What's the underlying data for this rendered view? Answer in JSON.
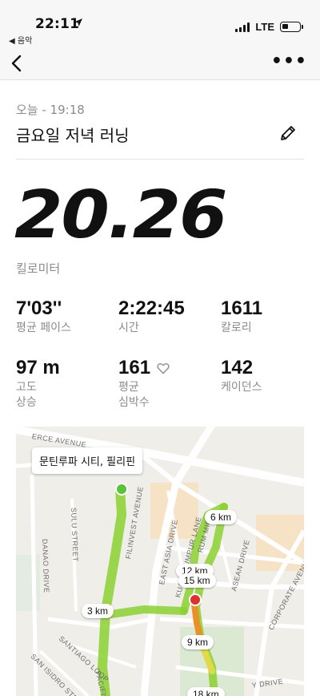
{
  "status_bar": {
    "time": "22:11",
    "back_app": "◀ 음악",
    "network": "LTE"
  },
  "nav": {
    "more_label": "•••"
  },
  "activity": {
    "date_line": "오늘 - 19:18",
    "title": "금요일 저녁 러닝",
    "distance": "20.26",
    "distance_unit": "킬로미터"
  },
  "stats": [
    {
      "value": "7'03''",
      "label": "평균 페이스"
    },
    {
      "value": "2:22:45",
      "label": "시간"
    },
    {
      "value": "1611",
      "label": "칼로리"
    },
    {
      "value": "97 m",
      "label": "고도\n상승"
    },
    {
      "value": "161",
      "label": "평균\n심박수"
    },
    {
      "value": "142",
      "label": "케이던스"
    }
  ],
  "map": {
    "callout": "문틴루파 시티, 필리핀",
    "km_markers": [
      "6 km",
      "12 km",
      "15 km",
      "3 km",
      "9 km",
      "18 km"
    ],
    "streets": [
      "ERCE AVENUE",
      "FILINVEST AVENUE",
      "EAST ASIA DRIVE",
      "KUALA LUMPUR LANE",
      "ASEAN DRIVE",
      "CORPORATE AVENUE",
      "DANAO DRIVE",
      "SULU STREET",
      "SANTIAGO LOOP",
      "SAN ISIDRO STREET",
      "RUM MID",
      "PACIFIC",
      "Y DRIVE"
    ],
    "colors": {
      "route": "#8bd12f",
      "route_slow": "#e9d94a",
      "route_fast": "#f08a24",
      "start": "#5ac436",
      "end": "#e03131"
    }
  }
}
